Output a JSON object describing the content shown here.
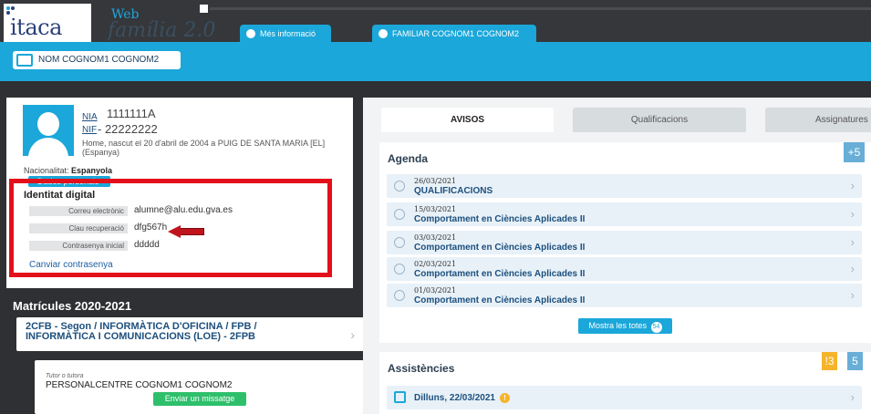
{
  "brand": {
    "logo": "itaca",
    "web": "Web",
    "subtitle": "família 2.0"
  },
  "header_tabs": [
    {
      "label": "Més informació",
      "icon": "info-icon"
    },
    {
      "label": "FAMILIAR COGNOM1 COGNOM2",
      "icon": "user-icon"
    }
  ],
  "student_chip": "NOM COGNOM1 COGNOM2",
  "profile": {
    "nia_label": "NIA",
    "nia_value": "1111111A",
    "nif_label": "NIF",
    "nif_value": "- 22222222",
    "birth": "Home, nascut el 20 d'abril de 2004 a PUIG DE SANTA MARIA [EL] (Espanya)",
    "nationality_label": "Nacionalitat:",
    "nationality_value": "Espanyola",
    "personal_data_button": "Dades personals"
  },
  "identity": {
    "title": "Identitat digital",
    "fields": [
      {
        "label": "Correu electrònic",
        "value": "alumne@alu.edu.gva.es"
      },
      {
        "label": "Clau recuperació",
        "value": "dfg567h"
      },
      {
        "label": "Contrasenya inicial",
        "value": "ddddd"
      }
    ],
    "change_password": "Canviar contrasenya"
  },
  "enrollments": {
    "title": "Matrícules 2020-2021",
    "course": "2CFB - Segon / INFORMÀTICA D'OFICINA / FPB / INFORMÀTICA I COMUNICACIONS (LOE) - 2FPB",
    "tutor_label": "Tutor o tutora",
    "tutor_name": "PERSONALCENTRE COGNOM1 COGNOM2",
    "message_button": "Enviar un missatge"
  },
  "tabs": [
    "AVISOS",
    "Qualificacions",
    "Assignatures"
  ],
  "agenda": {
    "title": "Agenda",
    "more_badge": "+5",
    "items": [
      {
        "date": "26/03/2021",
        "title": "QUALIFICACIONS"
      },
      {
        "date": "15/03/2021",
        "title": "Comportament en Ciències Aplicades II"
      },
      {
        "date": "03/03/2021",
        "title": "Comportament en Ciències Aplicades II"
      },
      {
        "date": "02/03/2021",
        "title": "Comportament en Ciències Aplicades II"
      },
      {
        "date": "01/03/2021",
        "title": "Comportament en Ciències Aplicades II"
      }
    ],
    "show_all": "Mostra les totes",
    "show_all_count": "54"
  },
  "attendance": {
    "title": "Assistències",
    "badge_warning": "!3",
    "badge_count": "5",
    "item": "Dilluns, 22/03/2021"
  }
}
